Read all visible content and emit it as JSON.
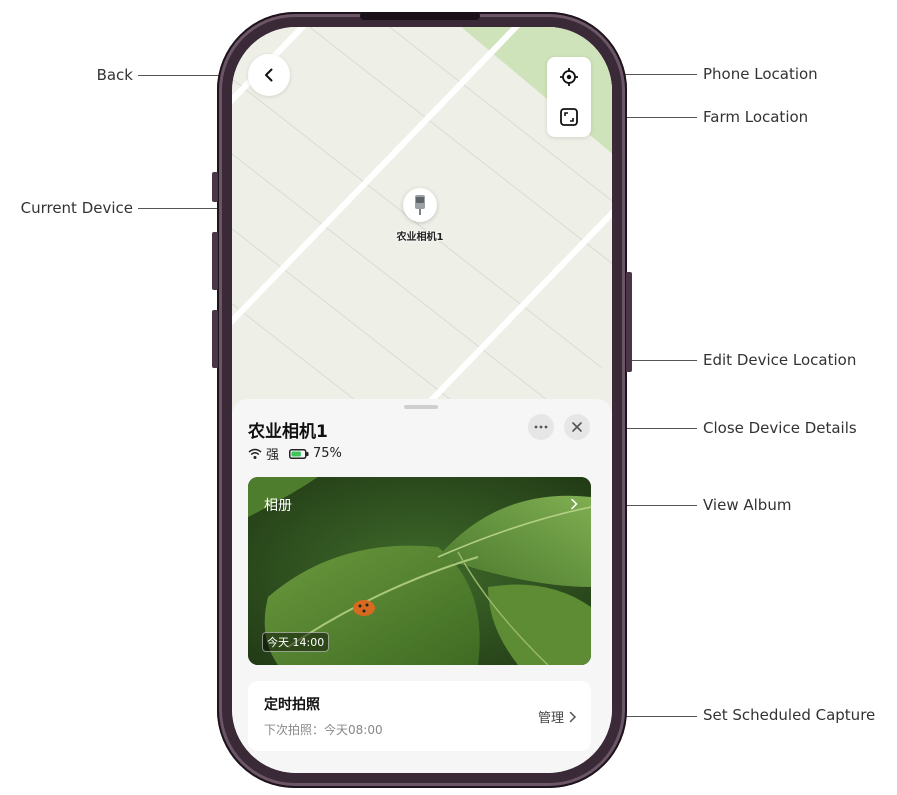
{
  "annotations": {
    "back": "Back",
    "current_device": "Current Device",
    "phone_location": "Phone Location",
    "farm_location": "Farm Location",
    "edit_device_location": "Edit Device Location",
    "close_device_details": "Close Device Details",
    "view_album": "View Album",
    "set_scheduled_capture": "Set Scheduled Capture"
  },
  "map": {
    "marker_label": "农业相机1",
    "back_icon": "chevron-left-icon",
    "phone_location_icon": "crosshair-icon",
    "farm_location_icon": "frame-icon"
  },
  "device": {
    "name": "农业相机1",
    "signal_icon": "wifi-icon",
    "signal_label": "强",
    "battery_icon": "battery-icon",
    "battery_percent": "75%",
    "battery_level": 0.75,
    "more_icon": "ellipsis-icon",
    "close_icon": "close-icon"
  },
  "album": {
    "title": "相册",
    "timestamp": "今天 14:00",
    "chevron_icon": "chevron-right-icon"
  },
  "schedule": {
    "title": "定时拍照",
    "next_capture": "下次拍照：今天08:00",
    "manage_label": "管理"
  },
  "colors": {
    "battery_green": "#3cc55a",
    "park_green": "#cfe3ba",
    "map_bg": "#eef0e8"
  }
}
